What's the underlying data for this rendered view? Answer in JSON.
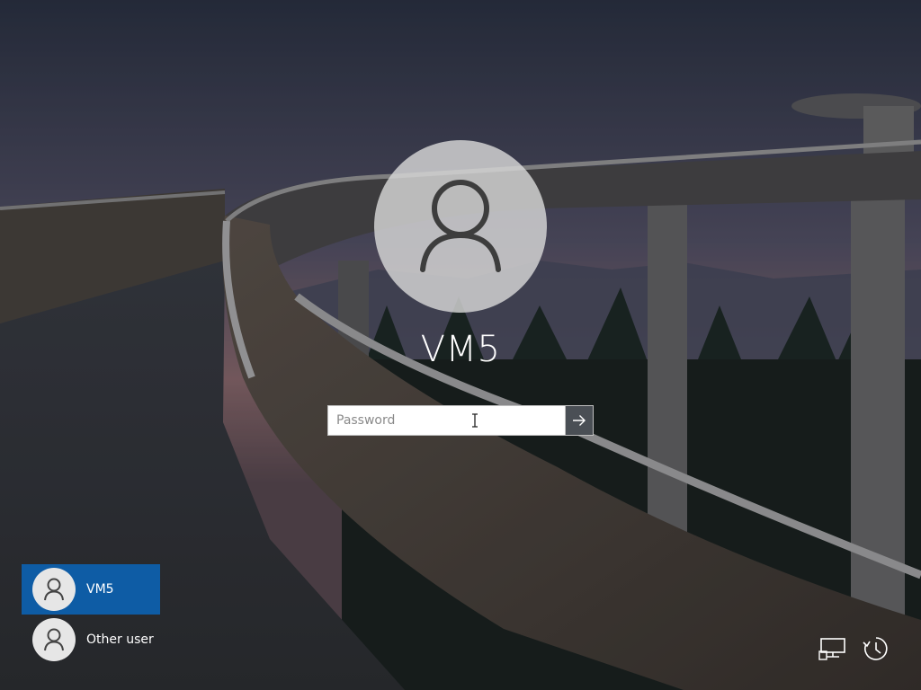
{
  "login": {
    "username": "VM5",
    "password_placeholder": "Password",
    "password_value": ""
  },
  "user_list": [
    {
      "name": "VM5",
      "selected": true
    },
    {
      "name": "Other user",
      "selected": false
    }
  ],
  "icons": {
    "avatar": "user-icon",
    "submit": "arrow-right-icon",
    "network": "network-icon",
    "ease_of_access": "ease-of-access-icon"
  },
  "colors": {
    "selected_user_bg": "#0e5ca5",
    "submit_button_bg": "#4a4f55"
  }
}
